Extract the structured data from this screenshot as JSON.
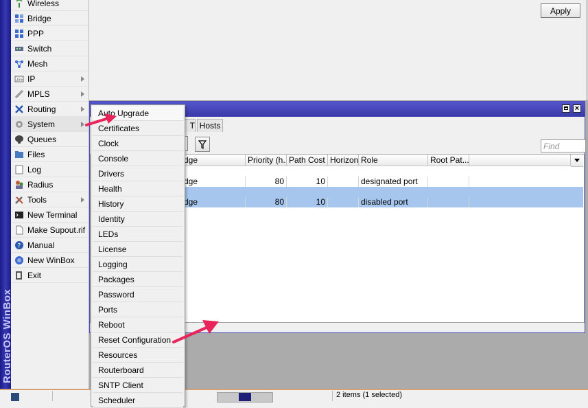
{
  "brand": {
    "text": "RouterOS WinBox"
  },
  "sidebar": {
    "items": [
      {
        "label": "Wireless",
        "icon": "wireless-icon",
        "submenu": false
      },
      {
        "label": "Bridge",
        "icon": "bridge-icon",
        "submenu": false
      },
      {
        "label": "PPP",
        "icon": "ppp-icon",
        "submenu": false
      },
      {
        "label": "Switch",
        "icon": "switch-icon",
        "submenu": false
      },
      {
        "label": "Mesh",
        "icon": "mesh-icon",
        "submenu": false
      },
      {
        "label": "IP",
        "icon": "ip-icon",
        "submenu": true
      },
      {
        "label": "MPLS",
        "icon": "mpls-icon",
        "submenu": true
      },
      {
        "label": "Routing",
        "icon": "routing-icon",
        "submenu": true
      },
      {
        "label": "System",
        "icon": "gear-icon",
        "submenu": true
      },
      {
        "label": "Queues",
        "icon": "queues-icon",
        "submenu": false
      },
      {
        "label": "Files",
        "icon": "folder-icon",
        "submenu": false
      },
      {
        "label": "Log",
        "icon": "log-icon",
        "submenu": false
      },
      {
        "label": "Radius",
        "icon": "radius-icon",
        "submenu": false
      },
      {
        "label": "Tools",
        "icon": "tools-icon",
        "submenu": true
      },
      {
        "label": "New Terminal",
        "icon": "terminal-icon",
        "submenu": false
      },
      {
        "label": "Make Supout.rif",
        "icon": "document-icon",
        "submenu": false
      },
      {
        "label": "Manual",
        "icon": "help-icon",
        "submenu": false
      },
      {
        "label": "New WinBox",
        "icon": "winbox-icon",
        "submenu": false
      },
      {
        "label": "Exit",
        "icon": "exit-icon",
        "submenu": false
      }
    ]
  },
  "top_panel": {
    "apply_label": "Apply"
  },
  "bridge_window": {
    "tabs": {
      "partial": "T",
      "hosts": "Hosts"
    },
    "find_placeholder": "Find",
    "columns": [
      "dge",
      "Priority (h...",
      "Path Cost",
      "Horizon",
      "Role",
      "Root Pat..."
    ],
    "rows": [
      {
        "bridge": "dge",
        "priority": "80",
        "path_cost": "10",
        "horizon": "",
        "role": "designated port",
        "root_path": "",
        "selected": false
      },
      {
        "bridge": "dge",
        "priority": "80",
        "path_cost": "10",
        "horizon": "",
        "role": "disabled port",
        "root_path": "",
        "selected": true
      }
    ]
  },
  "system_submenu": {
    "items": [
      "Auto Upgrade",
      "Certificates",
      "Clock",
      "Console",
      "Drivers",
      "Health",
      "History",
      "Identity",
      "LEDs",
      "License",
      "Logging",
      "Packages",
      "Password",
      "Ports",
      "Reboot",
      "Reset Configuration",
      "Resources",
      "Routerboard",
      "SNTP Client",
      "Scheduler"
    ]
  },
  "status_bar": {
    "text": "2 items (1 selected)"
  },
  "colors": {
    "title_bar": "#4646b8",
    "selection": "#a6c6ee",
    "annotation_arrow": "#e8245a",
    "brand_strip": "#2a2a9a"
  }
}
